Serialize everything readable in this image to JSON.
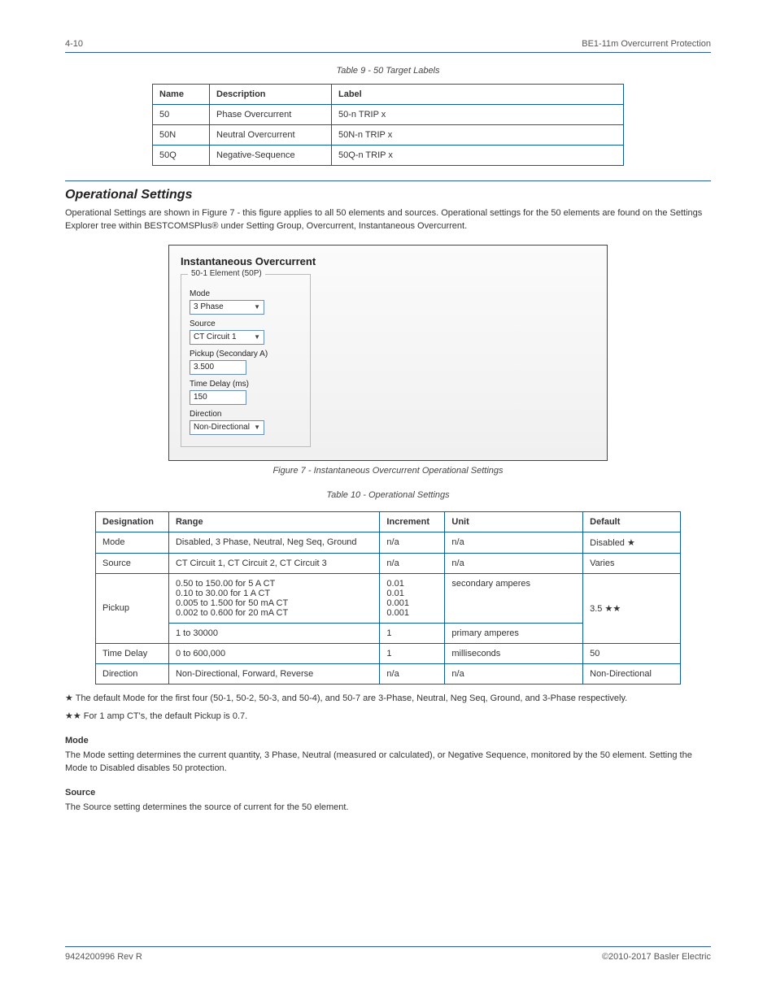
{
  "header": {
    "page_number": "4-10",
    "right_text": "BE1-11m Overcurrent Protection"
  },
  "table9": {
    "caption": "Table 9 - 50 Target Labels",
    "headers": [
      "Name",
      "Description",
      "Label"
    ],
    "rows": [
      [
        "50",
        "Phase Overcurrent",
        "50-n TRIP x"
      ],
      [
        "50N",
        "Neutral Overcurrent",
        "50N-n TRIP x"
      ],
      [
        "50Q",
        "Negative-Sequence",
        "50Q-n TRIP x"
      ]
    ]
  },
  "section": {
    "title": "Operational Settings",
    "paragraph": "Operational Settings are shown in Figure 7 - this figure applies to all 50 elements and sources. Operational settings for the 50 elements are found on the Settings Explorer tree within BESTCOMSPlus® under Setting Group, Overcurrent, Instantaneous Overcurrent."
  },
  "screenshot": {
    "title": "Instantaneous Overcurrent",
    "legend": "50-1 Element (50P)",
    "mode_label": "Mode",
    "mode_value": "3 Phase",
    "source_label": "Source",
    "source_value": "CT Circuit 1",
    "pickup_label": "Pickup (Secondary A)",
    "pickup_value": "3.500",
    "delay_label": "Time Delay (ms)",
    "delay_value": "150",
    "direction_label": "Direction",
    "direction_value": "Non-Directional"
  },
  "fig_caption": "Figure 7 - Instantaneous Overcurrent Operational Settings",
  "table10": {
    "caption": "Table 10 - Operational Settings",
    "headers": [
      "Designation",
      "Range",
      "Increment",
      "Unit",
      "Default"
    ],
    "rows": [
      [
        "Mode",
        "Disabled, 3 Phase, Neutral, Neg Seq, Ground",
        "n/a",
        "n/a",
        "Disabled ★"
      ],
      [
        "Source",
        "CT Circuit 1, CT Circuit 2, CT Circuit 3",
        "n/a",
        "n/a",
        "Varies"
      ],
      [
        "Pickup",
        "0.50 to 150.00 for 5 A CT\n0.10 to 30.00 for 1 A CT\n0.005 to 1.500 for 50 mA CT\n0.002 to 0.600 for 20 mA CT",
        "0.01\n0.01\n0.001\n0.001",
        "secondary amperes",
        "3.5 ★★"
      ],
      [
        "",
        "1 to 30000",
        "1",
        "primary amperes",
        ""
      ],
      [
        "Time Delay",
        "0 to 600,000",
        "1",
        "milliseconds",
        "50"
      ],
      [
        "Direction",
        "Non-Directional, Forward, Reverse",
        "n/a",
        "n/a",
        "Non-Directional"
      ]
    ],
    "merge_pickup_right": true
  },
  "footnotes": [
    "★ The default Mode for the first four (50-1, 50-2, 50-3, and 50-4), and 50-7 are 3-Phase, Neutral, Neg Seq, Ground, and 3-Phase respectively.",
    "★★ For 1 amp CT's, the default Pickup is 0.7."
  ],
  "subsection": {
    "mode_heading": "Mode",
    "mode_text": "The Mode setting determines the current quantity, 3 Phase, Neutral (measured or calculated), or Negative Sequence, monitored by the 50 element. Setting the Mode to Disabled disables 50 protection.",
    "source_heading": "Source",
    "source_text": "The Source setting determines the source of current for the 50 element."
  },
  "footer": {
    "left": "9424200996 Rev R",
    "right": "©2010-2017 Basler Electric"
  }
}
